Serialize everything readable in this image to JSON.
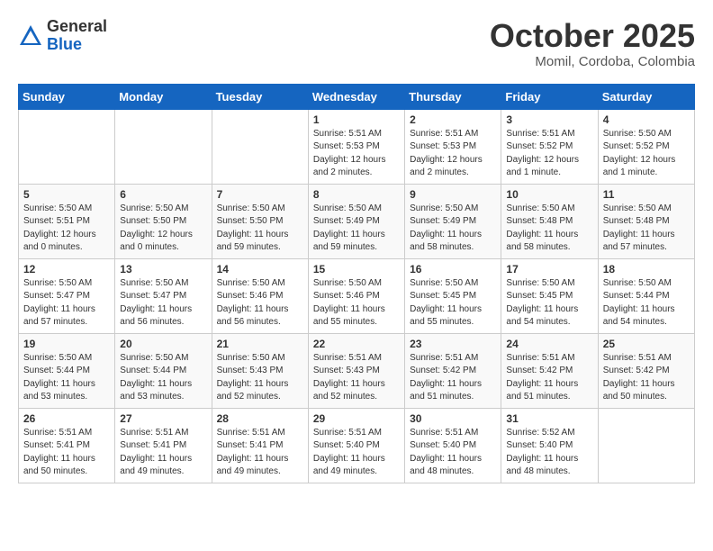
{
  "header": {
    "logo_general": "General",
    "logo_blue": "Blue",
    "month_title": "October 2025",
    "location": "Momil, Cordoba, Colombia"
  },
  "weekdays": [
    "Sunday",
    "Monday",
    "Tuesday",
    "Wednesday",
    "Thursday",
    "Friday",
    "Saturday"
  ],
  "weeks": [
    [
      {
        "day": "",
        "info": ""
      },
      {
        "day": "",
        "info": ""
      },
      {
        "day": "",
        "info": ""
      },
      {
        "day": "1",
        "info": "Sunrise: 5:51 AM\nSunset: 5:53 PM\nDaylight: 12 hours\nand 2 minutes."
      },
      {
        "day": "2",
        "info": "Sunrise: 5:51 AM\nSunset: 5:53 PM\nDaylight: 12 hours\nand 2 minutes."
      },
      {
        "day": "3",
        "info": "Sunrise: 5:51 AM\nSunset: 5:52 PM\nDaylight: 12 hours\nand 1 minute."
      },
      {
        "day": "4",
        "info": "Sunrise: 5:50 AM\nSunset: 5:52 PM\nDaylight: 12 hours\nand 1 minute."
      }
    ],
    [
      {
        "day": "5",
        "info": "Sunrise: 5:50 AM\nSunset: 5:51 PM\nDaylight: 12 hours\nand 0 minutes."
      },
      {
        "day": "6",
        "info": "Sunrise: 5:50 AM\nSunset: 5:50 PM\nDaylight: 12 hours\nand 0 minutes."
      },
      {
        "day": "7",
        "info": "Sunrise: 5:50 AM\nSunset: 5:50 PM\nDaylight: 11 hours\nand 59 minutes."
      },
      {
        "day": "8",
        "info": "Sunrise: 5:50 AM\nSunset: 5:49 PM\nDaylight: 11 hours\nand 59 minutes."
      },
      {
        "day": "9",
        "info": "Sunrise: 5:50 AM\nSunset: 5:49 PM\nDaylight: 11 hours\nand 58 minutes."
      },
      {
        "day": "10",
        "info": "Sunrise: 5:50 AM\nSunset: 5:48 PM\nDaylight: 11 hours\nand 58 minutes."
      },
      {
        "day": "11",
        "info": "Sunrise: 5:50 AM\nSunset: 5:48 PM\nDaylight: 11 hours\nand 57 minutes."
      }
    ],
    [
      {
        "day": "12",
        "info": "Sunrise: 5:50 AM\nSunset: 5:47 PM\nDaylight: 11 hours\nand 57 minutes."
      },
      {
        "day": "13",
        "info": "Sunrise: 5:50 AM\nSunset: 5:47 PM\nDaylight: 11 hours\nand 56 minutes."
      },
      {
        "day": "14",
        "info": "Sunrise: 5:50 AM\nSunset: 5:46 PM\nDaylight: 11 hours\nand 56 minutes."
      },
      {
        "day": "15",
        "info": "Sunrise: 5:50 AM\nSunset: 5:46 PM\nDaylight: 11 hours\nand 55 minutes."
      },
      {
        "day": "16",
        "info": "Sunrise: 5:50 AM\nSunset: 5:45 PM\nDaylight: 11 hours\nand 55 minutes."
      },
      {
        "day": "17",
        "info": "Sunrise: 5:50 AM\nSunset: 5:45 PM\nDaylight: 11 hours\nand 54 minutes."
      },
      {
        "day": "18",
        "info": "Sunrise: 5:50 AM\nSunset: 5:44 PM\nDaylight: 11 hours\nand 54 minutes."
      }
    ],
    [
      {
        "day": "19",
        "info": "Sunrise: 5:50 AM\nSunset: 5:44 PM\nDaylight: 11 hours\nand 53 minutes."
      },
      {
        "day": "20",
        "info": "Sunrise: 5:50 AM\nSunset: 5:44 PM\nDaylight: 11 hours\nand 53 minutes."
      },
      {
        "day": "21",
        "info": "Sunrise: 5:50 AM\nSunset: 5:43 PM\nDaylight: 11 hours\nand 52 minutes."
      },
      {
        "day": "22",
        "info": "Sunrise: 5:51 AM\nSunset: 5:43 PM\nDaylight: 11 hours\nand 52 minutes."
      },
      {
        "day": "23",
        "info": "Sunrise: 5:51 AM\nSunset: 5:42 PM\nDaylight: 11 hours\nand 51 minutes."
      },
      {
        "day": "24",
        "info": "Sunrise: 5:51 AM\nSunset: 5:42 PM\nDaylight: 11 hours\nand 51 minutes."
      },
      {
        "day": "25",
        "info": "Sunrise: 5:51 AM\nSunset: 5:42 PM\nDaylight: 11 hours\nand 50 minutes."
      }
    ],
    [
      {
        "day": "26",
        "info": "Sunrise: 5:51 AM\nSunset: 5:41 PM\nDaylight: 11 hours\nand 50 minutes."
      },
      {
        "day": "27",
        "info": "Sunrise: 5:51 AM\nSunset: 5:41 PM\nDaylight: 11 hours\nand 49 minutes."
      },
      {
        "day": "28",
        "info": "Sunrise: 5:51 AM\nSunset: 5:41 PM\nDaylight: 11 hours\nand 49 minutes."
      },
      {
        "day": "29",
        "info": "Sunrise: 5:51 AM\nSunset: 5:40 PM\nDaylight: 11 hours\nand 49 minutes."
      },
      {
        "day": "30",
        "info": "Sunrise: 5:51 AM\nSunset: 5:40 PM\nDaylight: 11 hours\nand 48 minutes."
      },
      {
        "day": "31",
        "info": "Sunrise: 5:52 AM\nSunset: 5:40 PM\nDaylight: 11 hours\nand 48 minutes."
      },
      {
        "day": "",
        "info": ""
      }
    ]
  ]
}
